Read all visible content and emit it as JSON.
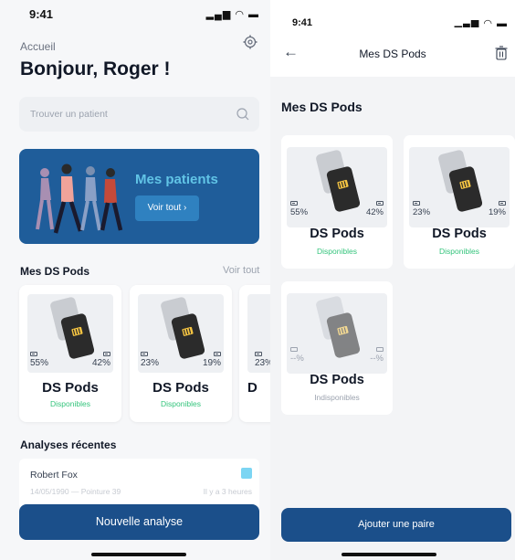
{
  "left_screen": {
    "status_bar": {
      "time": "9:41",
      "signal": "▂▄▆ ◠ ▬"
    },
    "breadcrumb": "Accueil",
    "greeting": "Bonjour, Roger !",
    "search": {
      "placeholder": "Trouver un patient"
    },
    "banner": {
      "title": "Mes patients",
      "button_label": "Voir tout ›"
    },
    "pods_section": {
      "title": "Mes DS Pods",
      "link": "Voir tout"
    },
    "pods": [
      {
        "left_battery": "55%",
        "right_battery": "42%",
        "name": "DS Pods",
        "status": "Disponibles"
      },
      {
        "left_battery": "23%",
        "right_battery": "19%",
        "name": "DS Pods",
        "status": "Disponibles"
      },
      {
        "left_battery": "23%",
        "name": "D"
      }
    ],
    "recent_section": {
      "title": "Analyses récentes"
    },
    "recent_analysis": {
      "patient": "Robert Fox",
      "info": "14/05/1990 — Pointure 39",
      "time": "Il y a 3 heures"
    },
    "cta": "Nouvelle analyse"
  },
  "right_screen": {
    "status_bar": {
      "time": "9:41",
      "signal": "▂▄▆ ◠ ▬"
    },
    "nav": {
      "back": "←",
      "title": "Mes DS Pods"
    },
    "section_title": "Mes DS Pods",
    "pods": [
      {
        "left_battery": "55%",
        "right_battery": "42%",
        "name": "DS Pods",
        "status": "Disponibles"
      },
      {
        "left_battery": "23%",
        "right_battery": "19%",
        "name": "DS Pods",
        "status": "Disponibles"
      },
      {
        "left_battery": "--%",
        "right_battery": "--%",
        "name": "DS Pods",
        "status": "Indisponibles"
      }
    ],
    "cta": "Ajouter une paire"
  },
  "colors": {
    "primary": "#1b4f8a",
    "banner": "#1f5d9a",
    "accent": "#61c4e6",
    "available": "#34c47c",
    "unavailable": "#9ca3af"
  }
}
